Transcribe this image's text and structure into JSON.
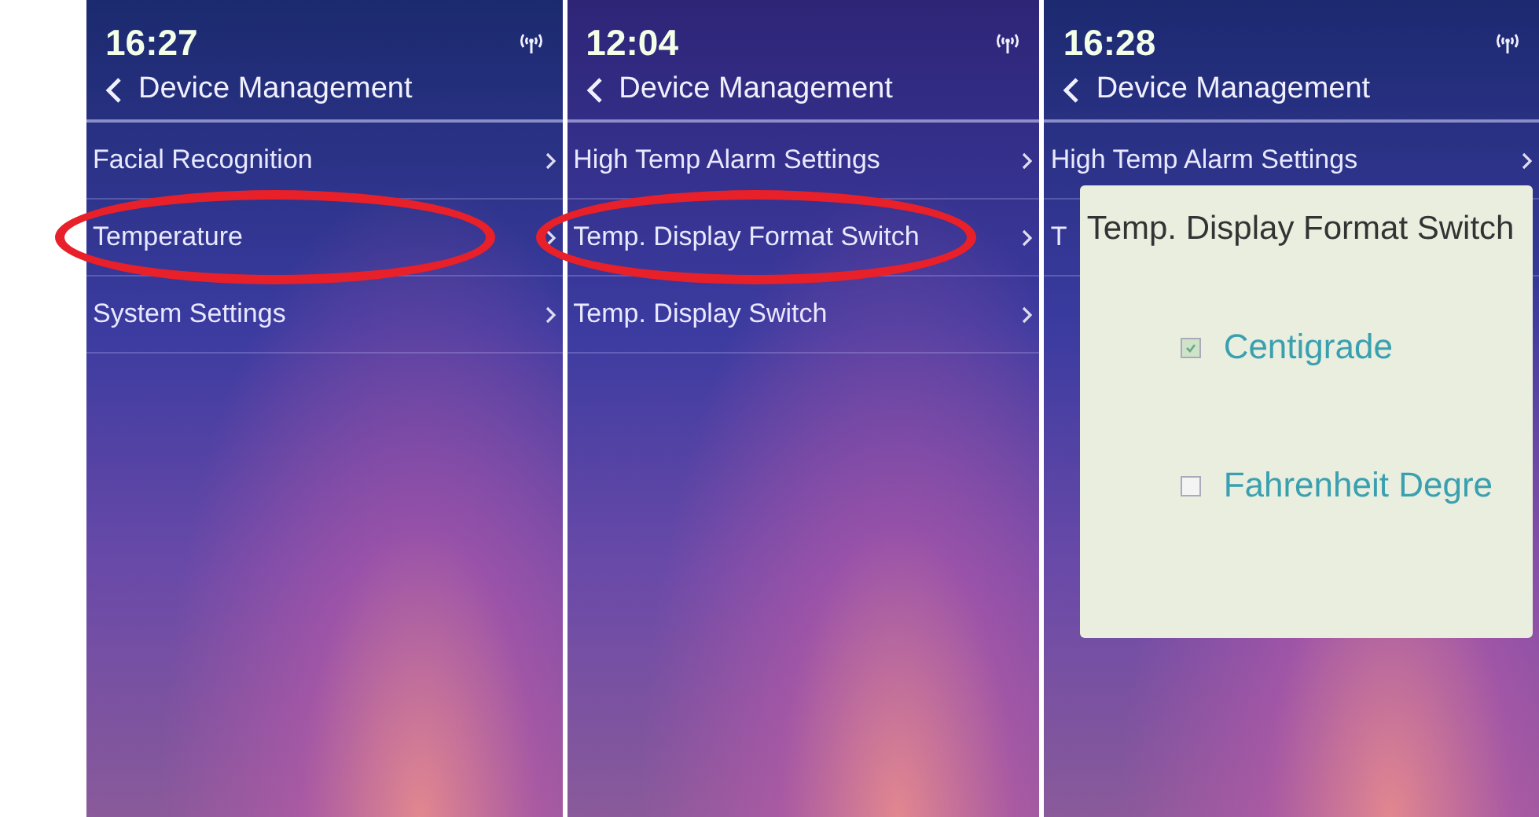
{
  "screens": [
    {
      "time": "16:27",
      "title": "Device Management",
      "items": [
        {
          "label": "Facial Recognition",
          "highlighted": false
        },
        {
          "label": "Temperature",
          "highlighted": true
        },
        {
          "label": "System Settings",
          "highlighted": false
        }
      ]
    },
    {
      "time": "12:04",
      "title": "Device Management",
      "items": [
        {
          "label": "High Temp Alarm Settings",
          "highlighted": false
        },
        {
          "label": "Temp. Display Format Switch",
          "highlighted": true
        },
        {
          "label": "Temp. Display Switch",
          "highlighted": false
        }
      ]
    },
    {
      "time": "16:28",
      "title": "Device Management",
      "items": [
        {
          "label": "High Temp Alarm Settings",
          "highlighted": false
        },
        {
          "label": "T",
          "highlighted": false
        }
      ],
      "dialog": {
        "title": "Temp. Display Format Switch",
        "options": [
          {
            "label": "Centigrade",
            "checked": true
          },
          {
            "label": "Fahrenheit Degre",
            "checked": false
          }
        ]
      }
    }
  ]
}
